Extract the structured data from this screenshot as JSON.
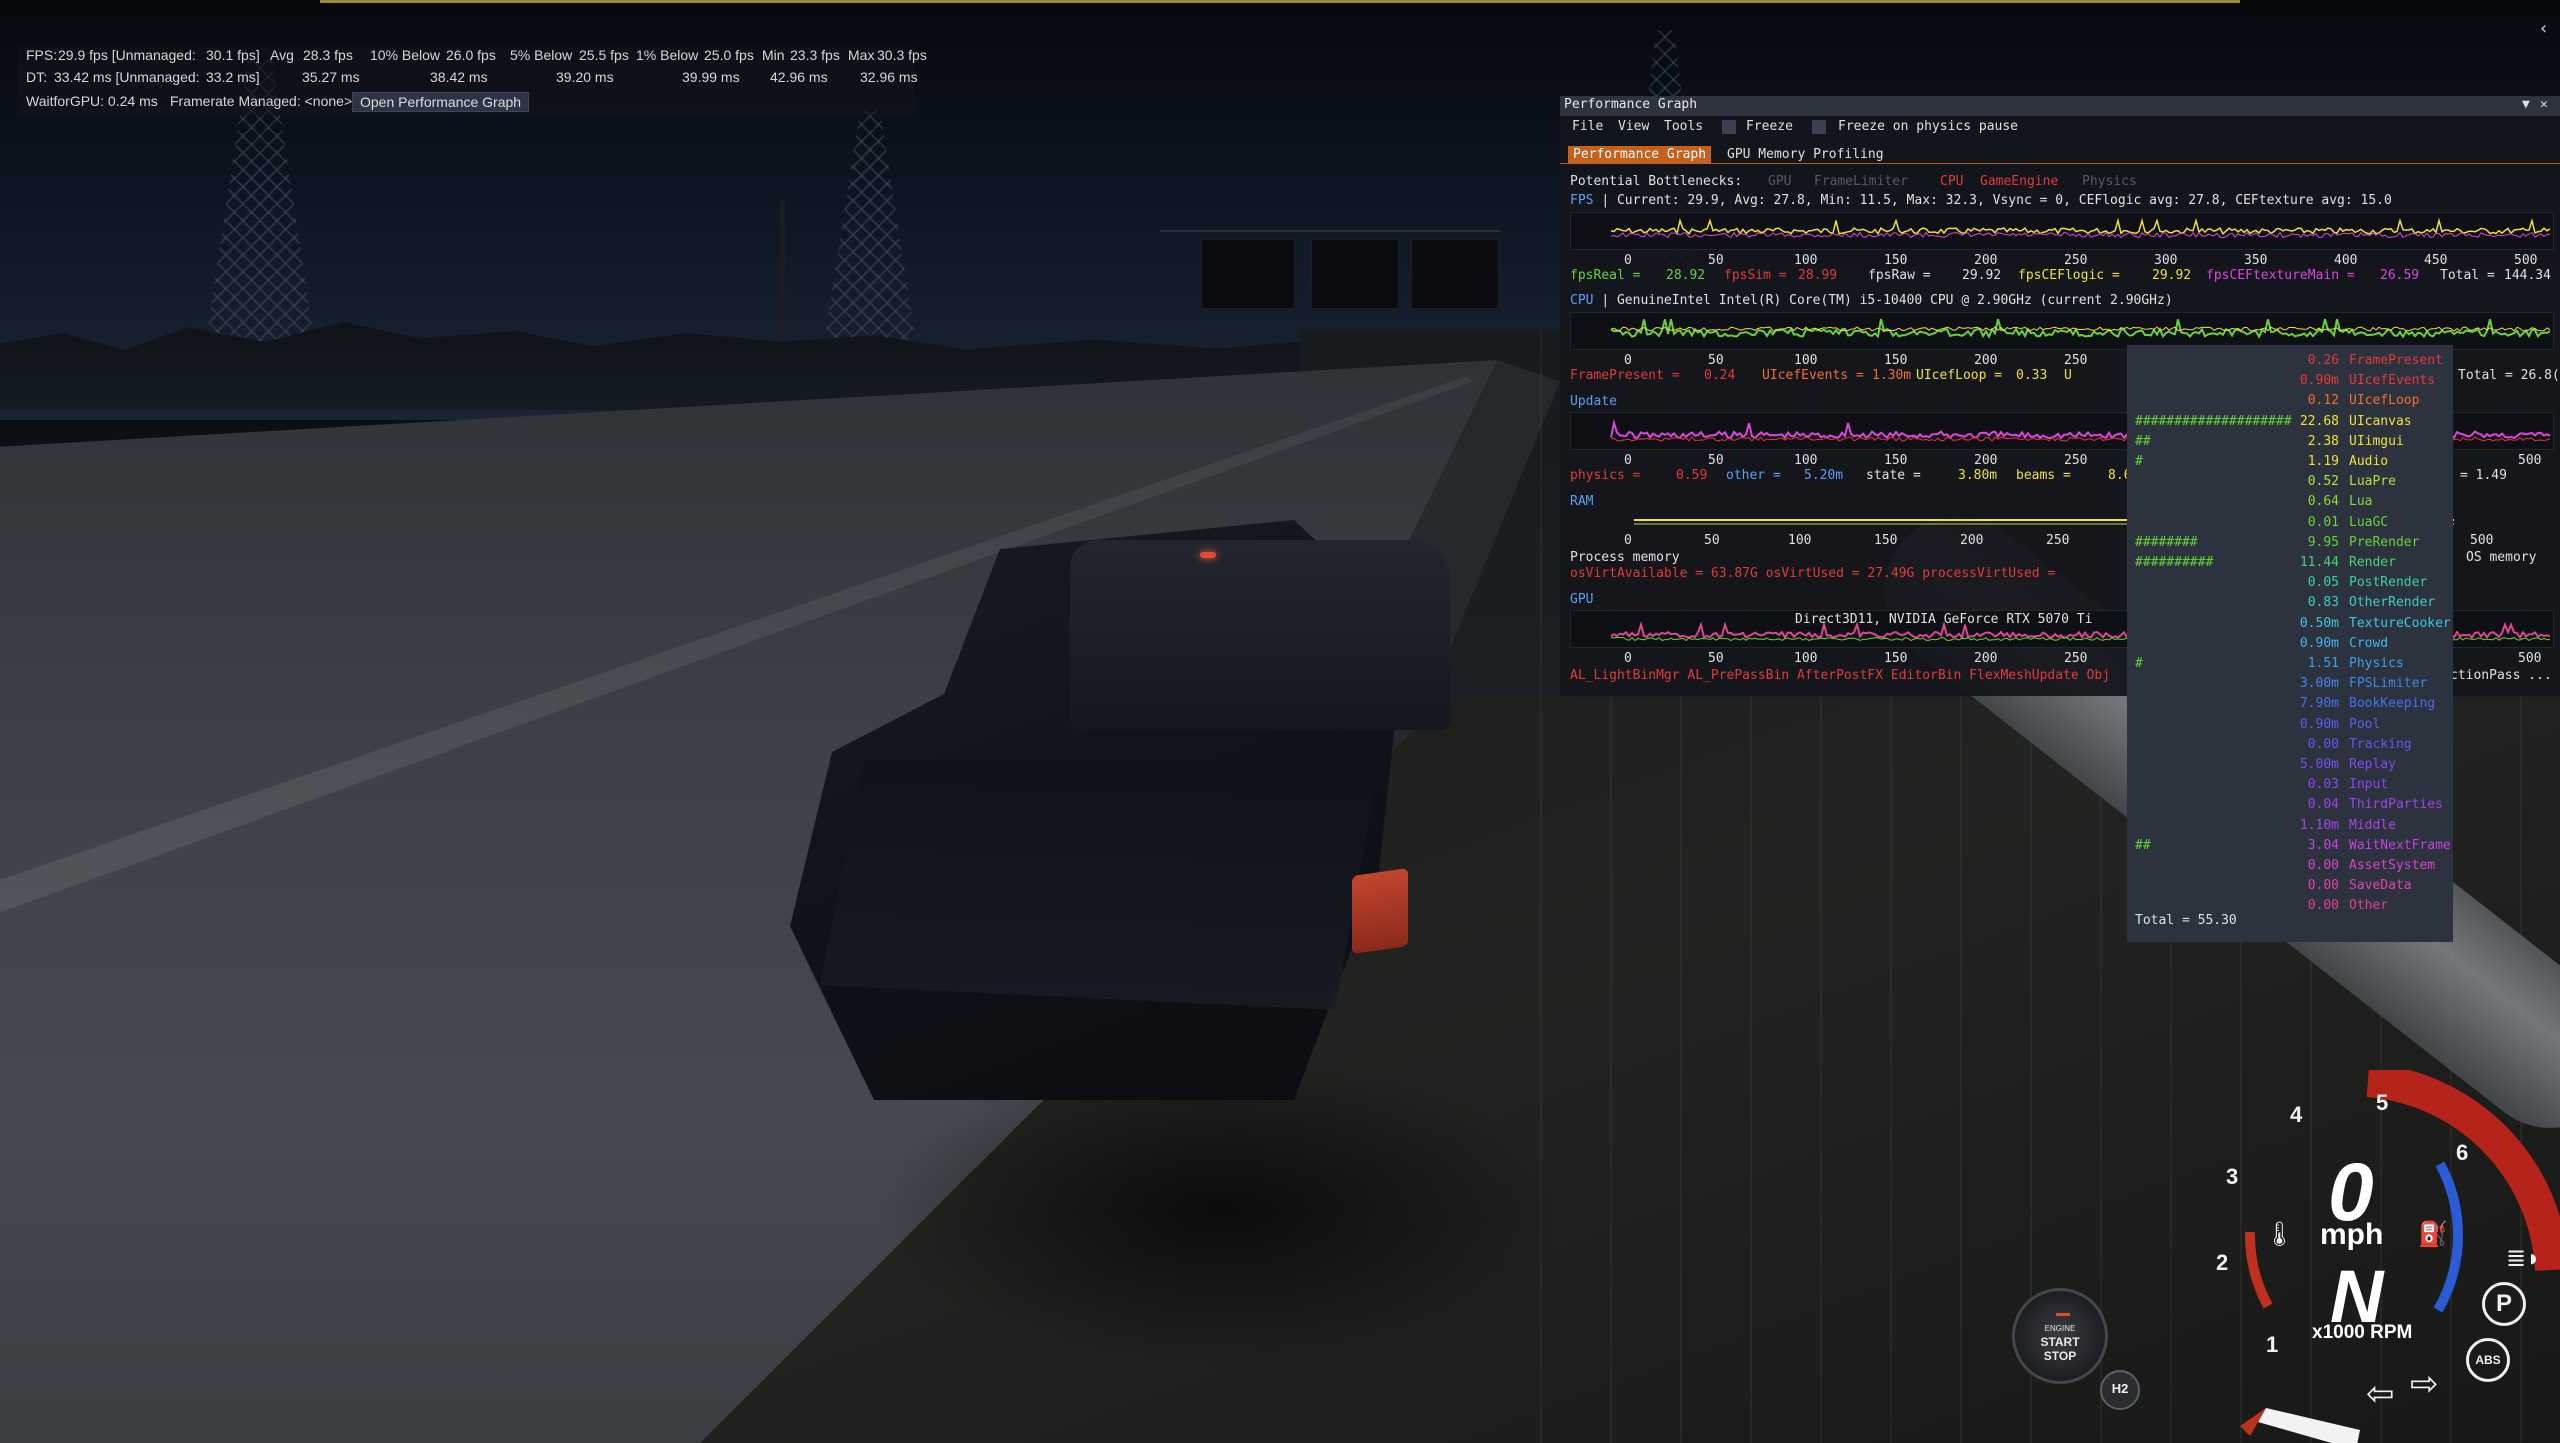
{
  "stats": {
    "row1": {
      "fps_label": "FPS:",
      "fps_value": "29.9 fps [Unmanaged:",
      "fps_unmanaged": "30.1 fps]",
      "avg_label": "Avg",
      "avg_value": "28.3 fps",
      "below10_label": "10% Below",
      "below10_value": "26.0 fps",
      "below5_label": "5% Below",
      "below5_value": "25.5 fps",
      "below1_label": "1% Below",
      "below1_value": "25.0 fps",
      "min_label": "Min",
      "min_value": "23.3 fps",
      "max_label": "Max",
      "max_value": "30.3 fps"
    },
    "row2": {
      "dt_label": "DT:",
      "dt_value": "33.42 ms [Unmanaged:",
      "dt_unmanaged": "33.2 ms]",
      "avg": "35.27 ms",
      "below10": "38.42 ms",
      "below5": "39.20 ms",
      "below1": "39.99 ms",
      "min": "42.96 ms",
      "max": "32.96 ms"
    },
    "row3": {
      "waitgpu": "WaitforGPU: 0.24 ms",
      "framerate": "Framerate Managed: <none>",
      "button": "Open Performance Graph"
    }
  },
  "perf_graph": {
    "title": "Performance Graph",
    "title_controls": [
      "▼",
      "✕"
    ],
    "menu": [
      "File",
      "View",
      "Tools"
    ],
    "freeze": "Freeze",
    "freeze_physics": "Freeze on physics pause",
    "tabs": [
      "Performance Graph",
      "GPU Memory Profiling"
    ],
    "bottlenecks": {
      "label": "Potential Bottlenecks:",
      "items": [
        {
          "text": "GPU",
          "color": "#555a66"
        },
        {
          "text": "FrameLimiter",
          "color": "#555a66"
        },
        {
          "text": "CPU",
          "color": "#e23b3b"
        },
        {
          "text": "GameEngine",
          "color": "#e23b3b"
        },
        {
          "text": "Physics",
          "color": "#555a66"
        }
      ]
    },
    "fps": {
      "label": "FPS",
      "summary": "| Current: 29.9, Avg: 27.8, Min: 11.5, Max: 32.3, Vsync = 0, CEFlogic avg: 27.8, CEFtexture avg: 15.0",
      "legend": [
        {
          "k": "fpsReal =",
          "v": "28.92"
        },
        {
          "k": "fpsSim =",
          "v": "28.99"
        },
        {
          "k": "fpsRaw =",
          "v": "29.92"
        },
        {
          "k": "fpsCEFlogic =",
          "v": "29.92"
        },
        {
          "k": "fpsCEFtextureMain =",
          "v": "26.59"
        },
        {
          "k": "Total =",
          "v": "144.34"
        }
      ]
    },
    "axis_ticks": [
      "0",
      "50",
      "100",
      "150",
      "200",
      "250",
      "300",
      "350",
      "400",
      "450",
      "500"
    ],
    "axis_ticks_short": [
      "0",
      "50",
      "100",
      "150",
      "200",
      "250"
    ],
    "cpu": {
      "label": "CPU",
      "summary": "| GenuineIntel Intel(R) Core(TM) i5-10400 CPU @ 2.90GHz (current 2.90GHz)",
      "legend": [
        {
          "k": "FramePresent =",
          "v": "0.24"
        },
        {
          "k": "UIcefEvents =",
          "v": "1.30m"
        },
        {
          "k": "UIcefLoop =",
          "v": "0.33"
        },
        {
          "k": "U",
          "v": ""
        }
      ],
      "total": "Total = 26.8("
    },
    "update": {
      "label": "Update",
      "legend": [
        {
          "k": "physics =",
          "v": "0.59"
        },
        {
          "k": "other =",
          "v": "5.20m"
        },
        {
          "k": "state =",
          "v": "3.80m"
        },
        {
          "k": "beams =",
          "v": "8.60m"
        }
      ],
      "right": "= 1.49"
    },
    "ram": {
      "label": "RAM",
      "process_memory": "Process memory",
      "legend": "osVirtAvailable = 63.87G osVirtUsed = 27.49G processVirtUsed =",
      "right_tick": "500",
      "os_memory": "OS memory"
    },
    "gpu": {
      "label": "GPU",
      "device": "Direct3D11, NVIDIA GeForce RTX 5070 Ti",
      "legend": "AL_LightBinMgr AL_PrePassBin AfterPostFX EditorBin FlexMeshUpdate Obj",
      "right": "ctionPass ..."
    }
  },
  "cpu_breakdown": {
    "rows": [
      {
        "bar": "",
        "value": "0.26",
        "name": "FramePresent",
        "color": "#e23b3b"
      },
      {
        "bar": "",
        "value": "0.90m",
        "name": "UIcefEvents",
        "color": "#e23b3b"
      },
      {
        "bar": "",
        "value": "0.12",
        "name": "UIcefLoop",
        "color": "#f07030"
      },
      {
        "bar": "####################",
        "value": "22.68",
        "name": "UIcanvas",
        "color": "#f0e22f"
      },
      {
        "bar": "##",
        "value": "2.38",
        "name": "UIimgui",
        "color": "#f0e22f"
      },
      {
        "bar": "#",
        "value": "1.19",
        "name": "Audio",
        "color": "#f0e22f"
      },
      {
        "bar": "",
        "value": "0.52",
        "name": "LuaPre",
        "color": "#b8e03a"
      },
      {
        "bar": "",
        "value": "0.64",
        "name": "Lua",
        "color": "#8fd83b"
      },
      {
        "bar": "",
        "value": "0.01",
        "name": "LuaGC",
        "color": "#67d33b"
      },
      {
        "bar": "########",
        "value": "9.95",
        "name": "PreRender",
        "color": "#67d33b"
      },
      {
        "bar": "##########",
        "value": "11.44",
        "name": "Render",
        "color": "#4ad37a"
      },
      {
        "bar": "",
        "value": "0.05",
        "name": "PostRender",
        "color": "#3fd0a0"
      },
      {
        "bar": "",
        "value": "0.83",
        "name": "OtherRender",
        "color": "#3fcfc0"
      },
      {
        "bar": "",
        "value": "0.50m",
        "name": "TextureCooker",
        "color": "#3fc8e0"
      },
      {
        "bar": "",
        "value": "0.90m",
        "name": "Crowd",
        "color": "#3fb8f0"
      },
      {
        "bar": "#",
        "value": "1.51",
        "name": "Physics",
        "color": "#3fa0f0"
      },
      {
        "bar": "",
        "value": "3.00m",
        "name": "FPSLimiter",
        "color": "#3f88f0"
      },
      {
        "bar": "",
        "value": "7.90m",
        "name": "BookKeeping",
        "color": "#4a70f0"
      },
      {
        "bar": "",
        "value": "0.90m",
        "name": "Pool",
        "color": "#5a5ff0"
      },
      {
        "bar": "",
        "value": "0.00",
        "name": "Tracking",
        "color": "#6a55f0"
      },
      {
        "bar": "",
        "value": "5.00m",
        "name": "Replay",
        "color": "#7a4ff0"
      },
      {
        "bar": "",
        "value": "0.03",
        "name": "Input",
        "color": "#8a48ef"
      },
      {
        "bar": "",
        "value": "0.04",
        "name": "ThirdParties",
        "color": "#9a45ec"
      },
      {
        "bar": "",
        "value": "1.10m",
        "name": "Middle",
        "color": "#ad43e8"
      },
      {
        "bar": "##",
        "value": "3.04",
        "name": "WaitNextFrame",
        "color": "#c444e4"
      },
      {
        "bar": "",
        "value": "0.00",
        "name": "AssetSystem",
        "color": "#d845d0"
      },
      {
        "bar": "",
        "value": "0.00",
        "name": "SaveData",
        "color": "#e045b0"
      },
      {
        "bar": "",
        "value": "0.00",
        "name": "Other",
        "color": "#e04590"
      }
    ],
    "total": "Total = 55.30"
  },
  "hud": {
    "speed": "0",
    "unit": "mph",
    "gear": "N",
    "rpm_label": "x1000 RPM",
    "gear_numbers": [
      "1",
      "2",
      "3",
      "4",
      "5",
      "6"
    ],
    "engine_button": {
      "engine": "ENGINE",
      "start": "START",
      "stop": "STOP"
    },
    "h2": "H2",
    "icons": {
      "temperature": "coolant-temperature-icon",
      "fuel": "fuel-icon",
      "lights": "headlight-icon",
      "parking": "parking-brake-icon",
      "abs": "abs-icon",
      "left_signal": "left-turn-signal-icon",
      "right_signal": "right-turn-signal-icon"
    },
    "parking_label": "P",
    "abs_label": "ABS"
  },
  "colors": {
    "accent_orange": "#c4611d",
    "graph_fps": "#f0e22f",
    "graph_cpu": "#67d33b",
    "graph_update": "#e045e0",
    "graph_gpu": "#e04590",
    "redline": "#b5231a",
    "dial_blue": "#2a5cd6"
  }
}
